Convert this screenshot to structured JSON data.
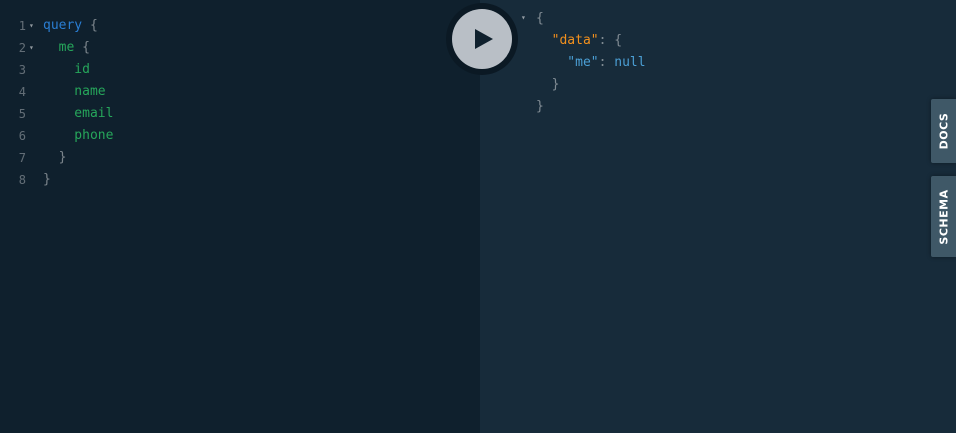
{
  "editor": {
    "lines": [
      {
        "num": "1",
        "fold": "▾",
        "tokens": [
          {
            "t": "query",
            "c": "kw"
          },
          {
            "t": " {",
            "c": "punc"
          }
        ]
      },
      {
        "num": "2",
        "fold": "▾",
        "tokens": [
          {
            "t": "  me",
            "c": "fld"
          },
          {
            "t": " {",
            "c": "punc"
          }
        ]
      },
      {
        "num": "3",
        "fold": "",
        "tokens": [
          {
            "t": "    id",
            "c": "fld"
          }
        ]
      },
      {
        "num": "4",
        "fold": "",
        "tokens": [
          {
            "t": "    name",
            "c": "fld"
          }
        ]
      },
      {
        "num": "5",
        "fold": "",
        "tokens": [
          {
            "t": "    email",
            "c": "fld"
          }
        ]
      },
      {
        "num": "6",
        "fold": "",
        "tokens": [
          {
            "t": "    phone",
            "c": "fld"
          }
        ]
      },
      {
        "num": "7",
        "fold": "",
        "tokens": [
          {
            "t": "  }",
            "c": "punc"
          }
        ]
      },
      {
        "num": "8",
        "fold": "",
        "tokens": [
          {
            "t": "}",
            "c": "punc"
          }
        ]
      }
    ]
  },
  "result": {
    "fold": "▾",
    "lines": [
      [
        {
          "t": "{",
          "c": "punc"
        }
      ],
      [
        {
          "t": "  \"data\"",
          "c": "rkey-o"
        },
        {
          "t": ": {",
          "c": "punc"
        }
      ],
      [
        {
          "t": "    \"me\"",
          "c": "rkey-b"
        },
        {
          "t": ": ",
          "c": "punc"
        },
        {
          "t": "null",
          "c": "rnull"
        }
      ],
      [
        {
          "t": "  }",
          "c": "punc"
        }
      ],
      [
        {
          "t": "}",
          "c": "punc"
        }
      ]
    ]
  },
  "toolbar": {
    "run_icon": "play-icon"
  },
  "side_tabs": {
    "docs": "DOCS",
    "schema": "SCHEMA"
  },
  "colors": {
    "editor_bg": "#0f202d",
    "result_bg": "#172b3a",
    "keyword": "#2a7ed3",
    "field": "#26a65b",
    "string_key": "#f2901d",
    "null": "#4b9fd5"
  }
}
